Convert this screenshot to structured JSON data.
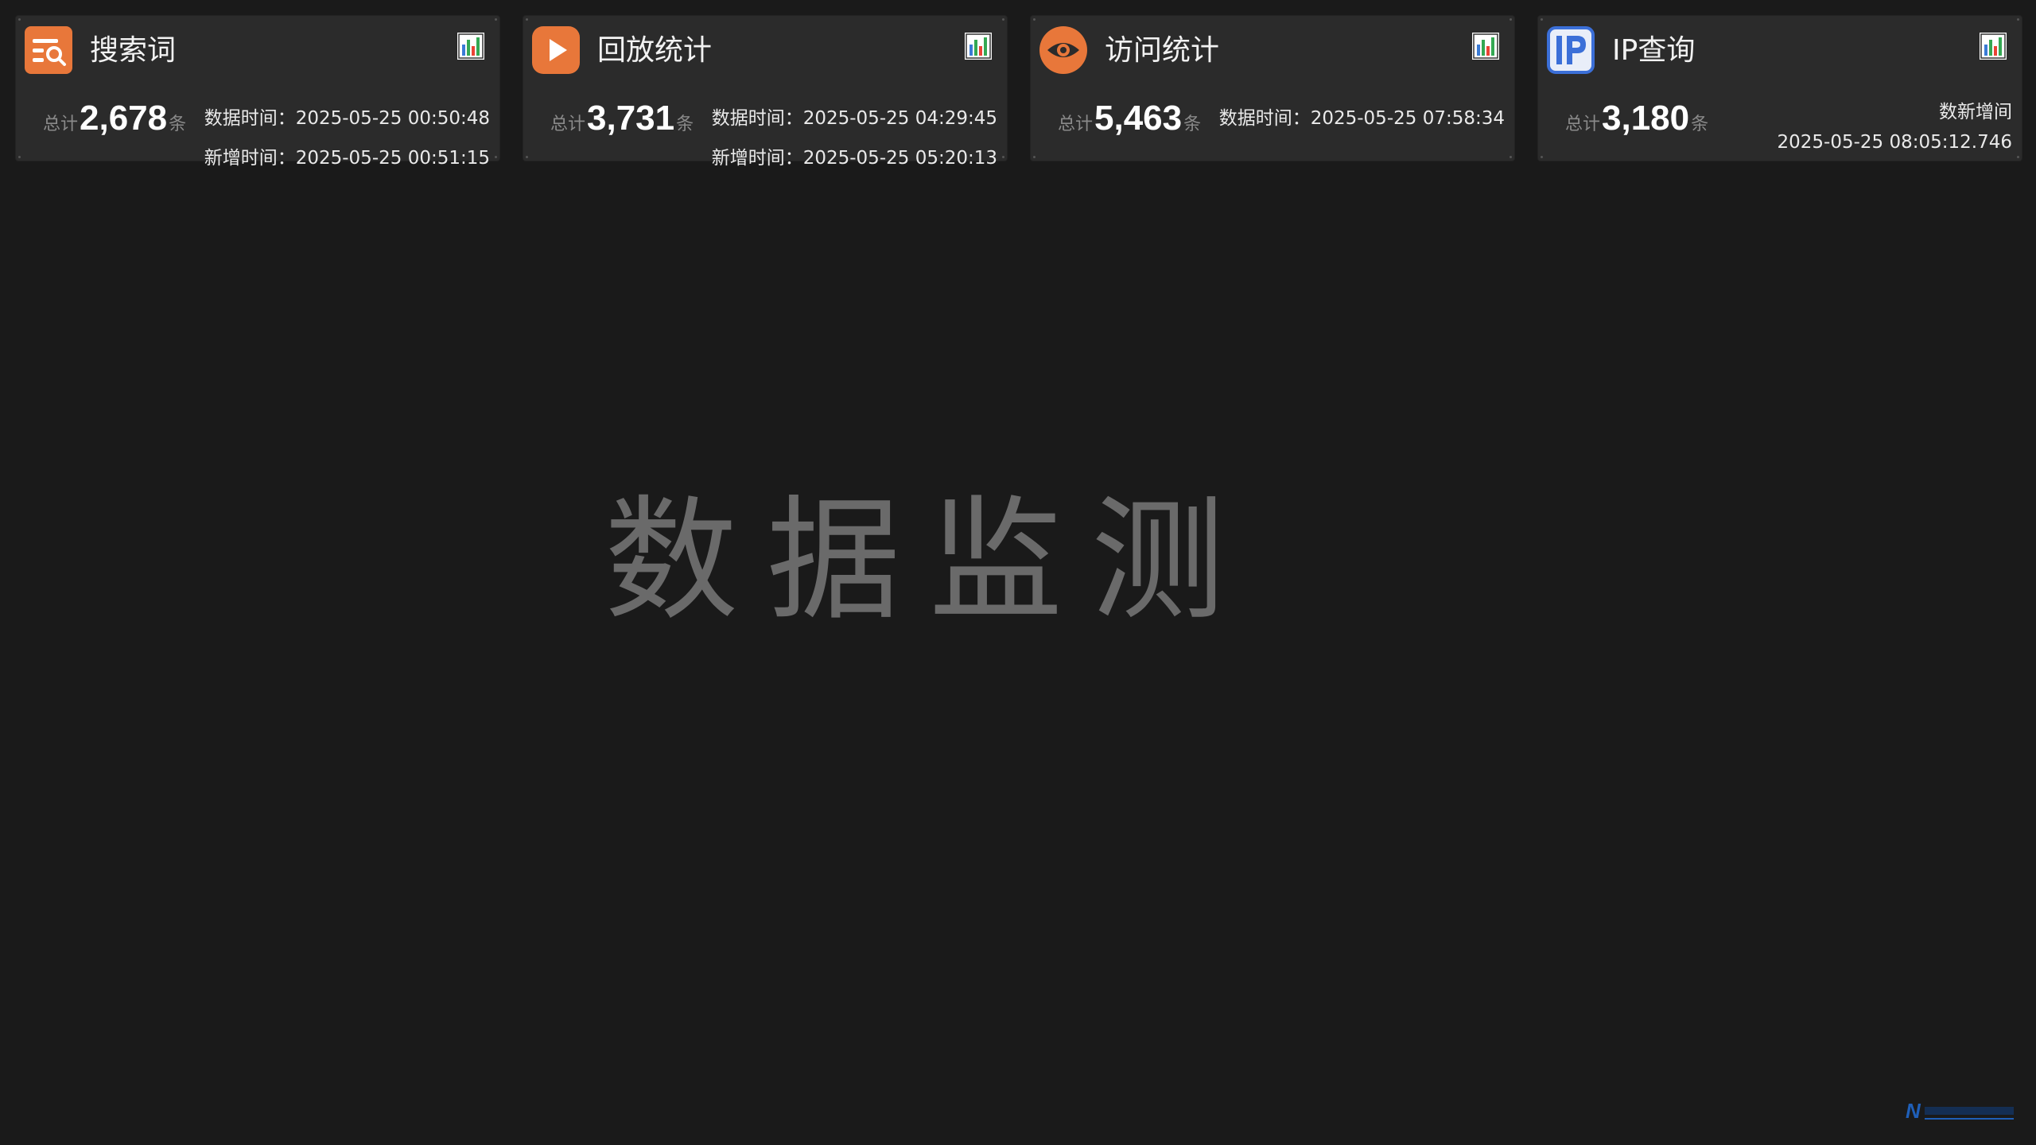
{
  "cards": [
    {
      "title": "搜索词",
      "icon": "search-list-icon",
      "icon_color": "#e8773a",
      "total_prefix": "总计",
      "total_value": "2,678",
      "total_suffix": "条",
      "line1": "数据时间：2025-05-25 00:50:48",
      "line2": "新增时间：2025-05-25 00:51:15"
    },
    {
      "title": "回放统计",
      "icon": "play-icon",
      "icon_color": "#e8773a",
      "total_prefix": "总计",
      "total_value": "3,731",
      "total_suffix": "条",
      "line1": "数据时间：2025-05-25 04:29:45",
      "line2": "新增时间：2025-05-25 05:20:13"
    },
    {
      "title": "访问统计",
      "icon": "eye-icon",
      "icon_color": "#e8773a",
      "total_prefix": "总计",
      "total_value": "5,463",
      "total_suffix": "条",
      "line1": "数据时间：2025-05-25 07:58:34"
    },
    {
      "title": "IP查询",
      "icon": "ip-icon",
      "icon_color": "#3b6fd8",
      "total_prefix": "总计",
      "total_value": "3,180",
      "total_suffix": "条",
      "line1": "数新增间",
      "line2": "2025-05-25 08:05:12.746"
    }
  ],
  "chart_icon": "bar-chart-icon",
  "watermark": "数据监测",
  "colors": {
    "background": "#1a1a1a",
    "card": "#2b2b2b",
    "accent": "#e8773a",
    "ip_blue": "#3b6fd8"
  }
}
